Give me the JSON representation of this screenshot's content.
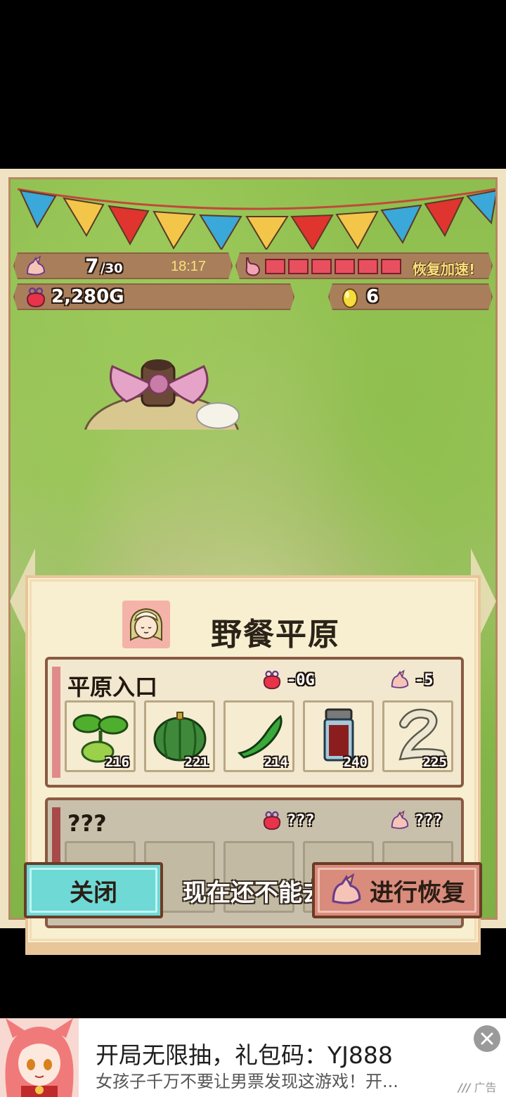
{
  "hud": {
    "stamina_current": "7",
    "stamina_max": "/30",
    "timer": "18:17",
    "hunger_segments": 6,
    "recover_speedup": "恢复加速!",
    "gold": "2,280G",
    "eggs": "6"
  },
  "panel": {
    "title": "野餐平原",
    "areas": [
      {
        "name": "平原入口",
        "gold_cost": "-0G",
        "stamina_cost": "-5",
        "items": [
          {
            "icon": "sprout-icon",
            "count": "216"
          },
          {
            "icon": "pumpkin-icon",
            "count": "221"
          },
          {
            "icon": "green-bean-icon",
            "count": "214"
          },
          {
            "icon": "spice-jar-icon",
            "count": "240"
          },
          {
            "icon": "white-noodle-icon",
            "count": "225"
          }
        ]
      },
      {
        "name": "???",
        "gold_cost": "???",
        "stamina_cost": "???",
        "locked_message": "现在还不能去"
      }
    ]
  },
  "buttons": {
    "close": "关闭",
    "recover": "进行恢复"
  },
  "ad": {
    "title": "开局无限抽，礼包码：YJ888",
    "subtitle": "女孩子千万不要让男票发现这游戏！开...",
    "tag": "广告"
  }
}
